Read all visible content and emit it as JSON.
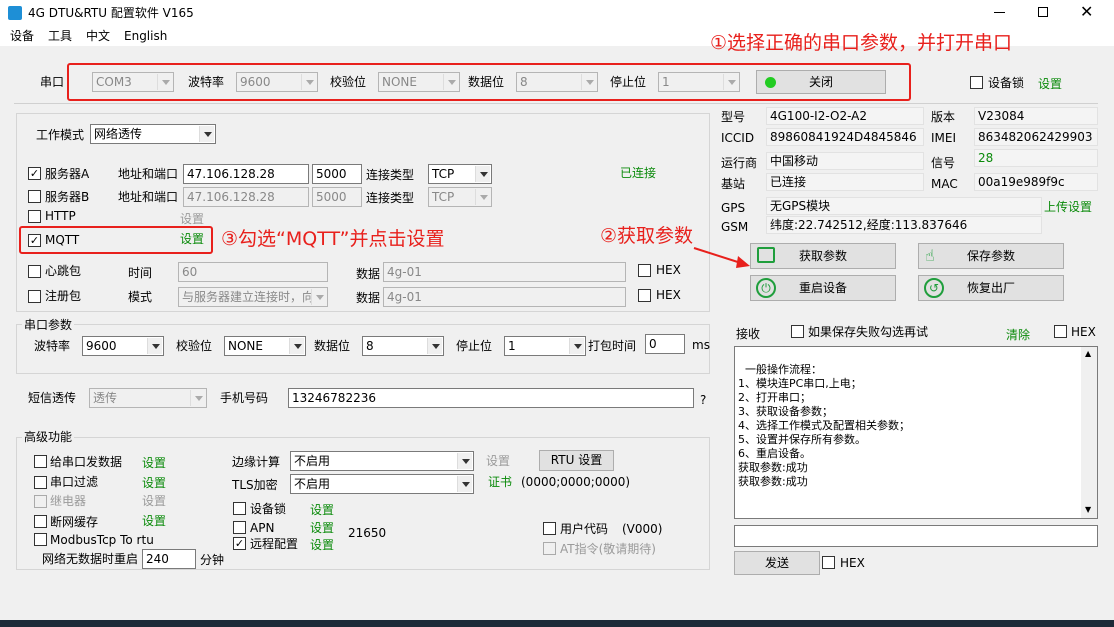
{
  "window": {
    "title": "4G DTU&RTU 配置软件  V165",
    "icon": "app-logo-icon"
  },
  "menu": [
    "设备",
    "工具",
    "中文",
    "English"
  ],
  "serial_top": {
    "port_label": "串口",
    "port": "COM3",
    "baud_label": "波特率",
    "baud": "9600",
    "parity_label": "校验位",
    "parity": "NONE",
    "data_label": "数据位",
    "data": "8",
    "stop_label": "停止位",
    "stop": "1",
    "close_button": "关闭",
    "device_lock_label": "设备锁",
    "device_lock_set": "设置"
  },
  "annotations": {
    "step1": "①选择正确的串口参数，并打开串口",
    "step2": "②获取参数",
    "step3": "③勾选“MQTT”并点击设置"
  },
  "work": {
    "mode_label": "工作模式",
    "mode": "网络透传",
    "server_a_label": "服务器A",
    "server_a_checked": true,
    "addr_label": "地址和端口",
    "server_a_host": "47.106.128.28",
    "server_a_port": "5000",
    "conn_type_label": "连接类型",
    "server_a_type": "TCP",
    "server_a_status": "已连接",
    "server_b_label": "服务器B",
    "server_b_host": "47.106.128.28",
    "server_b_port": "5000",
    "server_b_type": "TCP",
    "http_label": "HTTP",
    "http_set": "设置",
    "mqtt_label": "MQTT",
    "mqtt_checked": true,
    "mqtt_set": "设置",
    "heartbeat_label": "心跳包",
    "time_label": "时间",
    "heartbeat_time": "60",
    "data_label": "数据",
    "heartbeat_data": "4g-01",
    "hex_label": "HEX",
    "register_label": "注册包",
    "mode2_label": "模式",
    "register_mode": "与服务器建立连接时，向",
    "register_data": "4g-01"
  },
  "serial_params": {
    "group_label": "串口参数",
    "baud_label": "波特率",
    "baud": "9600",
    "parity_label": "校验位",
    "parity": "NONE",
    "data_label": "数据位",
    "data": "8",
    "stop_label": "停止位",
    "stop": "1",
    "pack_label": "打包时间",
    "pack": "0",
    "pack_unit": "ms"
  },
  "sms": {
    "label": "短信透传",
    "mode": "透传",
    "phone_label": "手机号码",
    "phone": "13246782236",
    "help": "?"
  },
  "advanced": {
    "group_label": "高级功能",
    "send_serial": "给串口发数据",
    "serial_filter": "串口过滤",
    "relay": "继电器",
    "break_cache": "断网缓存",
    "modbus": "ModbusTcp To rtu",
    "set": "设置",
    "edge_label": "边缘计算",
    "edge": "不启用",
    "tls_label": "TLS加密",
    "tls": "不启用",
    "rtu_button": "RTU 设置",
    "cert_label": "证书",
    "cert_value": "(0000;0000;0000)",
    "device_lock": "设备锁",
    "apn": "APN",
    "apn_value": "21650",
    "remote": "远程配置",
    "user_code": "用户代码",
    "user_code_value": "(V000)",
    "at_cmd": "AT指令(敬请期待)",
    "no_data_label": "网络无数据时重启",
    "no_data_value": "240",
    "no_data_unit": "分钟"
  },
  "info": {
    "model_label": "型号",
    "model": "4G100-I2-O2-A2",
    "version_label": "版本",
    "version": "V23084",
    "iccid_label": "ICCID",
    "iccid": "89860841924D4845846",
    "imei_label": "IMEI",
    "imei": "863482062429903",
    "operator_label": "运行商",
    "operator": "中国移动",
    "signal_label": "信号",
    "signal": "28",
    "station_label": "基站",
    "station": "已连接",
    "mac_label": "MAC",
    "mac": "00a19e989f9c",
    "gps_label": "GPS",
    "gps": "无GPS模块",
    "upload_set": "上传设置",
    "gsm_label": "GSM",
    "gsm": "纬度:22.742512,经度:113.837646"
  },
  "actions": {
    "get_params": "获取参数",
    "save_params": "保存参数",
    "restart": "重启设备",
    "factory": "恢复出厂"
  },
  "receive": {
    "label": "接收",
    "save_fail_label": "如果保存失败勾选再试",
    "clear": "清除",
    "hex": "HEX",
    "log": "一般操作流程：\n1、模块连PC串口,上电；\n2、打开串口；\n3、获取设备参数；\n4、选择工作模式及配置相关参数；\n5、设置并保存所有参数。\n6、重启设备。\n获取参数:成功\n获取参数:成功",
    "send_button": "发送",
    "send_hex": "HEX"
  },
  "colors": {
    "green": "#0a8a0a",
    "annotation_red": "#e8201c",
    "led_green": "#22cc22"
  }
}
